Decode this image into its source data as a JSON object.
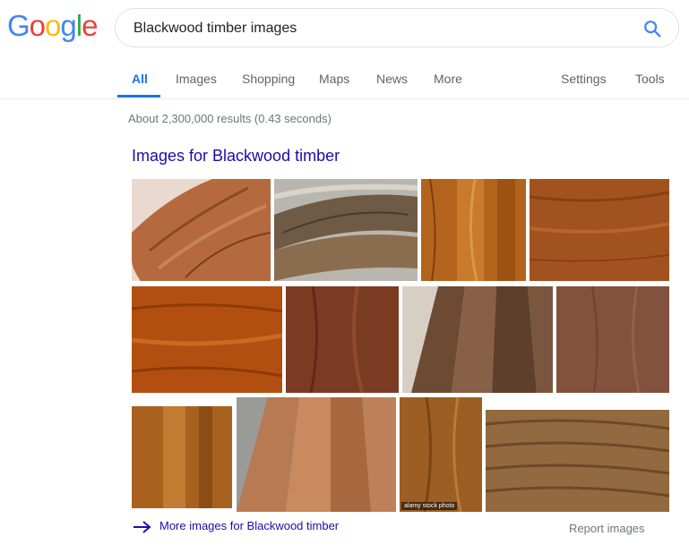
{
  "logo": {
    "letters": [
      "G",
      "o",
      "o",
      "g",
      "l",
      "e"
    ],
    "colors": [
      "#4285f4",
      "#ea4335",
      "#fbbc05",
      "#4285f4",
      "#34a853",
      "#ea4335"
    ]
  },
  "search": {
    "query": "Blackwood timber images",
    "icon": "search-icon"
  },
  "tabs": {
    "all": "All",
    "images": "Images",
    "shopping": "Shopping",
    "maps": "Maps",
    "news": "News",
    "more": "More",
    "settings": "Settings",
    "tools": "Tools"
  },
  "results_stats": "About 2,300,000 results (0.43 seconds)",
  "image_pack": {
    "heading": "Images for Blackwood timber",
    "thumb_watermark": "alamy stock photo",
    "more_link": "More images for Blackwood timber",
    "report": "Report images"
  },
  "colors": {
    "link": "#1a0dab",
    "accent": "#1a73e8",
    "muted": "#70757a"
  }
}
